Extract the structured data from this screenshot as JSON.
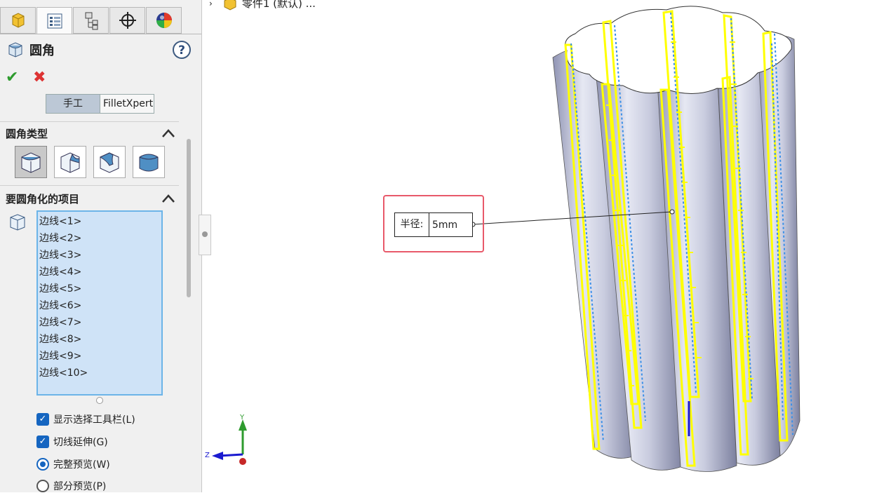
{
  "property_manager": {
    "title": "圆角",
    "help_glyph": "?",
    "ok_glyph": "✔",
    "cancel_glyph": "✖",
    "tabs": [
      "feature-manager-icon",
      "property-manager-icon",
      "configuration-manager-icon",
      "dimxpert-icon",
      "display-manager-icon"
    ],
    "modes": {
      "manual": "手工",
      "filletxpert": "FilletXpert"
    },
    "fillet_type": {
      "heading": "圆角类型"
    },
    "items": {
      "heading": "要圆角化的项目",
      "edges": [
        "边线<1>",
        "边线<2>",
        "边线<3>",
        "边线<4>",
        "边线<5>",
        "边线<6>",
        "边线<7>",
        "边线<8>",
        "边线<9>",
        "边线<10>"
      ]
    },
    "options": {
      "show_toolbar": "显示选择工具栏(L)",
      "tangent_propagation": "切线延伸(G)",
      "full_preview": "完整预览(W)",
      "partial_preview": "部分预览(P)"
    }
  },
  "viewport": {
    "breadcrumb": "零件1 (默认) ...",
    "radius_label": "半径:",
    "radius_value": "5mm",
    "triad": {
      "y": "Y",
      "z": "Z"
    }
  },
  "colors": {
    "highlight": "#ffff00",
    "accent": "#1565c0",
    "callout_border": "#e8596a"
  }
}
